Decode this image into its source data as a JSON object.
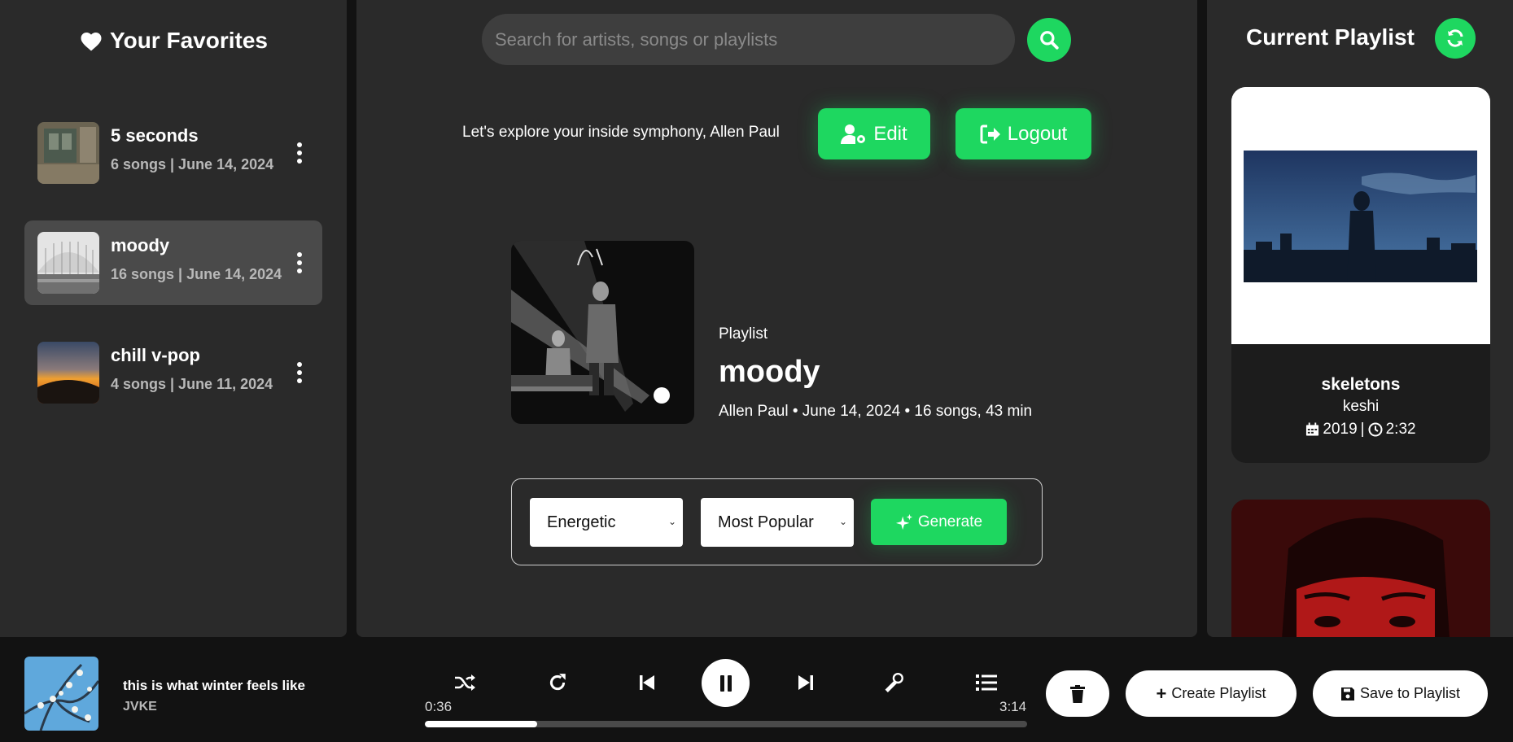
{
  "favorites": {
    "title": "Your Favorites",
    "items": [
      {
        "name": "5 seconds",
        "meta": "6 songs | June 14, 2024",
        "active": false
      },
      {
        "name": "moody",
        "meta": "16 songs | June 14, 2024",
        "active": true
      },
      {
        "name": "chill v-pop",
        "meta": "4 songs | June 11, 2024",
        "active": false
      }
    ]
  },
  "search": {
    "placeholder": "Search for artists, songs or playlists"
  },
  "header": {
    "welcome": "Let's explore your inside symphony, Allen Paul",
    "edit_label": "Edit",
    "logout_label": "Logout"
  },
  "playlist": {
    "label": "Playlist",
    "name": "moody",
    "info": "Allen Paul • June 14, 2024 • 16 songs, 43 min"
  },
  "generator": {
    "mood_selected": "Energetic",
    "sort_selected": "Most Popular",
    "generate_label": "Generate"
  },
  "current_playlist": {
    "title": "Current Playlist",
    "cards": [
      {
        "title": "skeletons",
        "artist": "keshi",
        "year": "2019",
        "duration": "2:32"
      }
    ]
  },
  "player": {
    "title": "this is what winter feels like",
    "artist": "JVKE",
    "elapsed": "0:36",
    "total": "3:14",
    "progress_fraction": 0.186,
    "create_label": "Create Playlist",
    "save_label": "Save to Playlist"
  },
  "colors": {
    "accent": "#1ed760",
    "panel": "#2a2a2a",
    "background": "#121212"
  }
}
